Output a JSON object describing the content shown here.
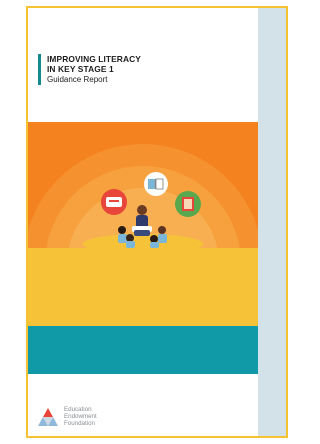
{
  "document": {
    "title_line1": "IMPROVING LITERACY",
    "title_line2": "IN KEY STAGE 1",
    "subtitle": "Guidance Report"
  },
  "publisher": {
    "line1": "Education",
    "line2": "Endowment",
    "line3": "Foundation"
  },
  "colors": {
    "frame": "#f5c232",
    "back_panel": "#d3e2e9",
    "orange": "#f4821f",
    "yellow": "#f6c338",
    "teal": "#109aa8"
  }
}
